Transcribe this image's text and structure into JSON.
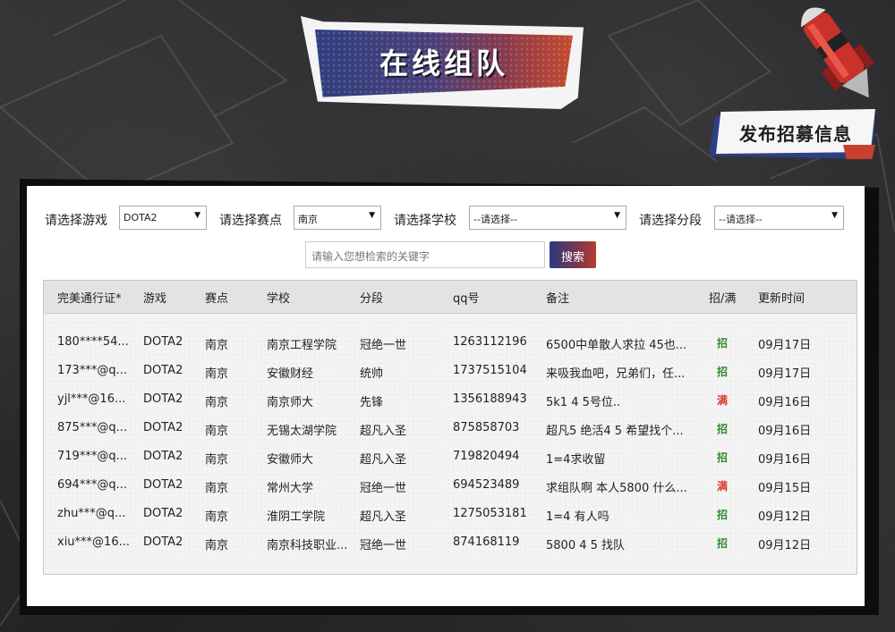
{
  "title": "在线组队",
  "publish_label": "发布招募信息",
  "filters": {
    "game_label": "请选择游戏",
    "game_value": "DOTA2",
    "venue_label": "请选择赛点",
    "venue_value": "南京",
    "school_label": "请选择学校",
    "school_value": "--请选择--",
    "rank_label": "请选择分段",
    "rank_value": "--请选择--"
  },
  "search": {
    "placeholder": "请输入您想检索的关键字",
    "button": "搜索"
  },
  "table": {
    "headers": [
      "完美通行证*",
      "游戏",
      "赛点",
      "学校",
      "分段",
      "qq号",
      "备注",
      "招/满",
      "更新时间"
    ],
    "rows": [
      {
        "account": "180****54...",
        "game": "DOTA2",
        "venue": "南京",
        "school": "南京工程学院",
        "rank": "冠绝一世",
        "qq": "1263112196",
        "note": "6500中单散人求拉 45也...",
        "status": "招",
        "updated": "09月17日"
      },
      {
        "account": "173***@q...",
        "game": "DOTA2",
        "venue": "南京",
        "school": "安徽财经",
        "rank": "统帅",
        "qq": "1737515104",
        "note": "来吸我血吧，兄弟们，任...",
        "status": "招",
        "updated": "09月17日"
      },
      {
        "account": "yjl***@16...",
        "game": "DOTA2",
        "venue": "南京",
        "school": "南京师大",
        "rank": "先锋",
        "qq": "1356188943",
        "note": "5k1 4 5号位..",
        "status": "满",
        "updated": "09月16日"
      },
      {
        "account": "875***@q...",
        "game": "DOTA2",
        "venue": "南京",
        "school": "无锡太湖学院",
        "rank": "超凡入圣",
        "qq": "875858703",
        "note": "超凡5 绝活4 5 希望找个...",
        "status": "招",
        "updated": "09月16日"
      },
      {
        "account": "719***@q...",
        "game": "DOTA2",
        "venue": "南京",
        "school": "安徽师大",
        "rank": "超凡入圣",
        "qq": "719820494",
        "note": "1=4求收留",
        "status": "招",
        "updated": "09月16日"
      },
      {
        "account": "694***@q...",
        "game": "DOTA2",
        "venue": "南京",
        "school": "常州大学",
        "rank": "冠绝一世",
        "qq": "694523489",
        "note": "求组队啊 本人5800 什么...",
        "status": "满",
        "updated": "09月15日"
      },
      {
        "account": "zhu***@q...",
        "game": "DOTA2",
        "venue": "南京",
        "school": "淮阴工学院",
        "rank": "超凡入圣",
        "qq": "1275053181",
        "note": "1=4 有人吗",
        "status": "招",
        "updated": "09月12日"
      },
      {
        "account": "xiu***@16...",
        "game": "DOTA2",
        "venue": "南京",
        "school": "南京科技职业...",
        "rank": "冠绝一世",
        "qq": "874168119",
        "note": "5800 4 5 找队",
        "status": "招",
        "updated": "09月12日"
      }
    ]
  }
}
